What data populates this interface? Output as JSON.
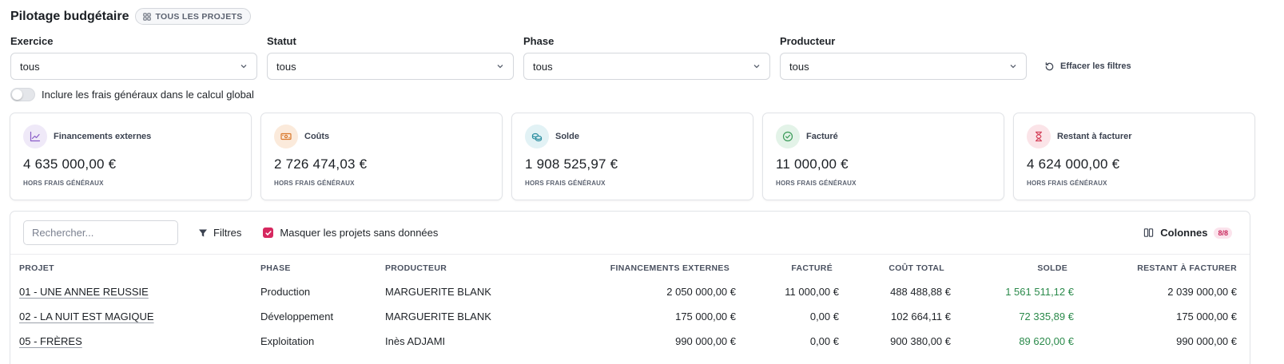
{
  "header": {
    "title": "Pilotage budgétaire",
    "badge": "TOUS LES PROJETS"
  },
  "filters": [
    {
      "label": "Exercice",
      "value": "tous"
    },
    {
      "label": "Statut",
      "value": "tous"
    },
    {
      "label": "Phase",
      "value": "tous"
    },
    {
      "label": "Producteur",
      "value": "tous"
    }
  ],
  "clear_filters": "Effacer les filtres",
  "toggle": {
    "label": "Inclure les frais généraux dans le calcul global",
    "on": false
  },
  "cards": [
    {
      "label": "Financements externes",
      "value": "4 635 000,00 €",
      "note": "HORS FRAIS GÉNÉRAUX",
      "icon": "trend-up-icon",
      "color": "#8a5cc8",
      "bg": "#efe9f8"
    },
    {
      "label": "Coûts",
      "value": "2 726 474,03 €",
      "note": "HORS FRAIS GÉNÉRAUX",
      "icon": "banknote-icon",
      "color": "#d9772b",
      "bg": "#fbeadb"
    },
    {
      "label": "Solde",
      "value": "1 908 525,97 €",
      "note": "HORS FRAIS GÉNÉRAUX",
      "icon": "coins-icon",
      "color": "#2c8ea0",
      "bg": "#e2f2f5"
    },
    {
      "label": "Facturé",
      "value": "11 000,00 €",
      "note": "HORS FRAIS GÉNÉRAUX",
      "icon": "check-circle-icon",
      "color": "#3a9a58",
      "bg": "#e3f3e8"
    },
    {
      "label": "Restant à facturer",
      "value": "4 624 000,00 €",
      "note": "HORS FRAIS GÉNÉRAUX",
      "icon": "hourglass-icon",
      "color": "#d4425a",
      "bg": "#fbe4e8"
    }
  ],
  "toolbar": {
    "search_placeholder": "Rechercher...",
    "filters_label": "Filtres",
    "mask_label": "Masquer les projets sans données",
    "mask_checked": true,
    "columns_label": "Colonnes",
    "columns_count": "8/8"
  },
  "table": {
    "headers": [
      "PROJET",
      "PHASE",
      "PRODUCTEUR",
      "FINANCEMENTS EXTERNES",
      "FACTURÉ",
      "COÛT TOTAL",
      "SOLDE",
      "RESTANT À FACTURER"
    ],
    "rows": [
      {
        "projet": "01 - UNE ANNEE REUSSIE",
        "phase": "Production",
        "producteur": "MARGUERITE BLANK",
        "financements": "2 050 000,00 €",
        "facture": "11 000,00 €",
        "cout": "488 488,88 €",
        "solde": "1 561 511,12 €",
        "restant": "2 039 000,00 €"
      },
      {
        "projet": "02 - LA NUIT EST MAGIQUE",
        "phase": "Développement",
        "producteur": "MARGUERITE BLANK",
        "financements": "175 000,00 €",
        "facture": "0,00 €",
        "cout": "102 664,11 €",
        "solde": "72 335,89 €",
        "restant": "175 000,00 €"
      },
      {
        "projet": "05 - FRÈRES",
        "phase": "Exploitation",
        "producteur": "Inès ADJAMI",
        "financements": "990 000,00 €",
        "facture": "0,00 €",
        "cout": "900 380,00 €",
        "solde": "89 620,00 €",
        "restant": "990 000,00 €"
      }
    ]
  }
}
